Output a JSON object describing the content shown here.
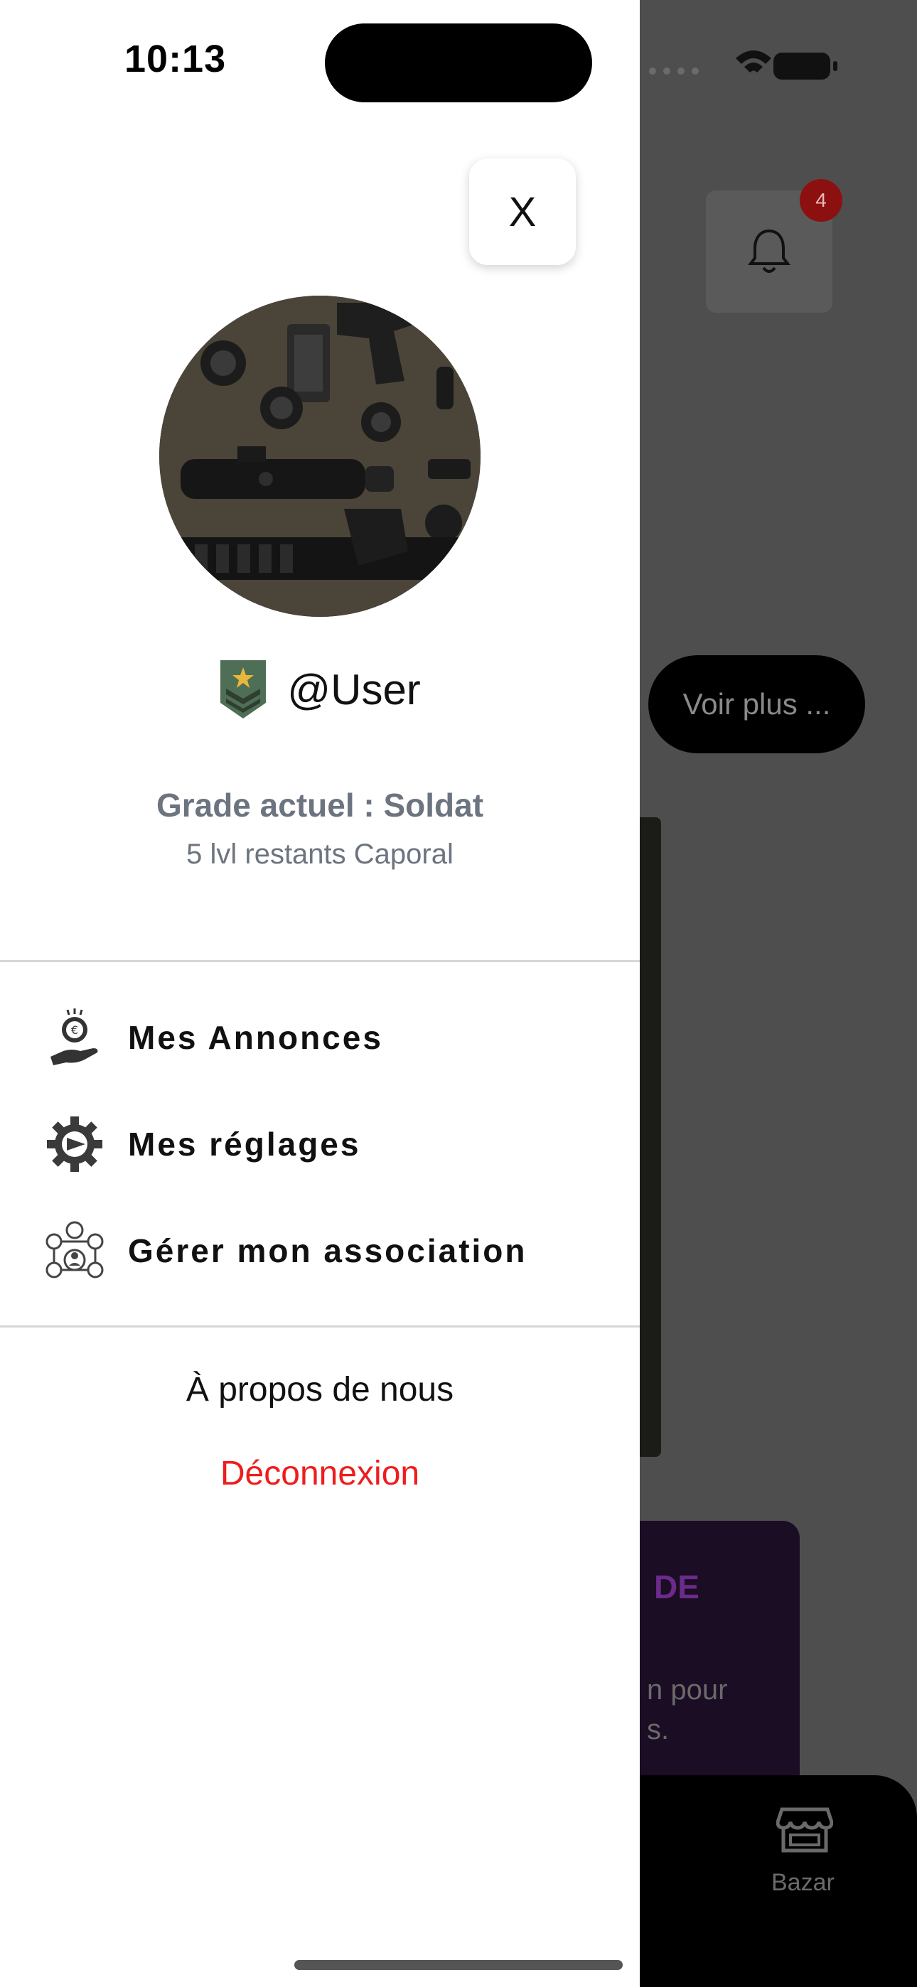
{
  "status_bar": {
    "time": "10:13"
  },
  "drawer": {
    "close_label": "X",
    "username": "@User",
    "grade_title": "Grade actuel : Soldat",
    "grade_subtitle": "5 lvl restants Caporal",
    "menu": [
      {
        "label": "Mes Annonces",
        "icon": "hand-coin-icon"
      },
      {
        "label": "Mes réglages",
        "icon": "gear-icon"
      },
      {
        "label": "Gérer mon association",
        "icon": "network-people-icon"
      }
    ],
    "about_label": "À propos de nous",
    "logout_label": "Déconnexion"
  },
  "background": {
    "notification_count": "4",
    "voir_plus_label": "Voir plus ...",
    "promo_title_fragment": "DE",
    "promo_text_fragment_1": "n pour",
    "promo_text_fragment_2": "s.",
    "tab_bazar_label": "Bazar"
  },
  "colors": {
    "logout": "#ee1d1d",
    "grade_text": "#6c7480",
    "badge": "#8c1010",
    "overlay": "#4e4e4e"
  }
}
